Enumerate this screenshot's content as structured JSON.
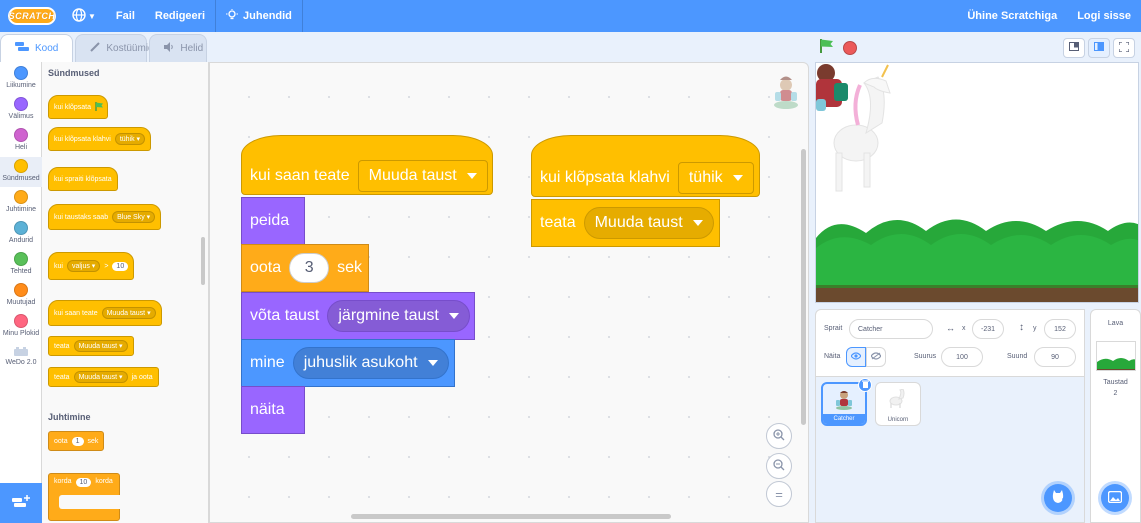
{
  "menubar": {
    "logo": "SCRATCH",
    "file": "Fail",
    "edit": "Redigeeri",
    "tutorials": "Juhendid",
    "join": "Ühine Scratchiga",
    "signin": "Logi sisse"
  },
  "tabs": {
    "code": "Kood",
    "costumes": "Kostüümid",
    "sounds": "Helid"
  },
  "categories": [
    {
      "label": "Liikumine",
      "color": "#4c97ff"
    },
    {
      "label": "Välimus",
      "color": "#9966ff"
    },
    {
      "label": "Heli",
      "color": "#cf63cf"
    },
    {
      "label": "Sündmused",
      "color": "#ffbf00"
    },
    {
      "label": "Juhtimine",
      "color": "#ffab19"
    },
    {
      "label": "Andurid",
      "color": "#5cb1d6"
    },
    {
      "label": "Tehted",
      "color": "#59c059"
    },
    {
      "label": "Muutujad",
      "color": "#ff8c1a"
    },
    {
      "label": "Minu Plokid",
      "color": "#ff6680"
    },
    {
      "label": "WeDo 2.0",
      "color": "#c7d2e3"
    }
  ],
  "palette": {
    "events_heading": "Sündmused",
    "when_flag": "kui klõpsata",
    "when_key": "kui klõpsata klahvi",
    "when_key_value": "tühik",
    "when_sprite": "kui spraiti klõpsata",
    "when_backdrop": "kui taustaks saab",
    "when_backdrop_value": "Blue Sky",
    "when_gt": "kui",
    "when_gt_value": "valjus",
    "when_gt_num": "10",
    "when_receive": "kui saan teate",
    "when_receive_value": "Muuda taust",
    "broadcast": "teata",
    "broadcast_value": "Muuda taust",
    "broadcast_wait": "teata",
    "broadcast_wait_value": "Muuda taust",
    "broadcast_wait_suffix": "ja oota",
    "control_heading": "Juhtimine",
    "wait": "oota",
    "wait_value": "1",
    "wait_unit": "sek",
    "repeat": "korda",
    "repeat_value": "10",
    "repeat_suffix": "korda"
  },
  "workspace": {
    "script1": {
      "hat": "kui saan teate",
      "hat_value": "Muuda taust",
      "hide": "peida",
      "wait": "oota",
      "wait_value": "3",
      "wait_unit": "sek",
      "switch": "võta taust",
      "switch_value": "järgmine taust",
      "goto": "mine",
      "goto_value": "juhuslik asukoht",
      "show": "näita"
    },
    "script2": {
      "hat": "kui klõpsata klahvi",
      "hat_value": "tühik",
      "broadcast": "teata",
      "broadcast_value": "Muuda taust"
    },
    "zoom_in": "+",
    "zoom_out": "−",
    "zoom_reset": "="
  },
  "sprite_info": {
    "sprite_label": "Sprait",
    "sprite_name": "Catcher",
    "x_label": "x",
    "x_value": "-231",
    "y_label": "y",
    "y_value": "152",
    "show_label": "Näita",
    "size_label": "Suurus",
    "size_value": "100",
    "direction_label": "Suund",
    "direction_value": "90"
  },
  "sprites": [
    {
      "name": "Catcher",
      "selected": true
    },
    {
      "name": "Unicorn",
      "selected": false
    }
  ],
  "stage_panel": {
    "title": "Lava",
    "backdrops_label": "Taustad",
    "backdrops_count": "2"
  }
}
